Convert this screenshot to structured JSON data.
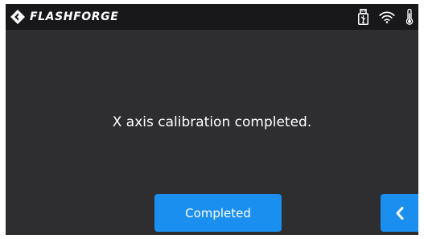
{
  "header": {
    "brand_name": "FLASHFORGE",
    "logo_icon": "flashforge-logo-icon",
    "status_icons": [
      "usb-drive-icon",
      "wifi-icon",
      "thermometer-icon"
    ]
  },
  "main": {
    "message": "X axis calibration completed."
  },
  "actions": {
    "completed_label": "Completed",
    "back_icon": "chevron-left-icon"
  },
  "colors": {
    "background": "#2e2e31",
    "topbar": "#18181a",
    "accent": "#1a8ff0",
    "text": "#ffffff"
  }
}
